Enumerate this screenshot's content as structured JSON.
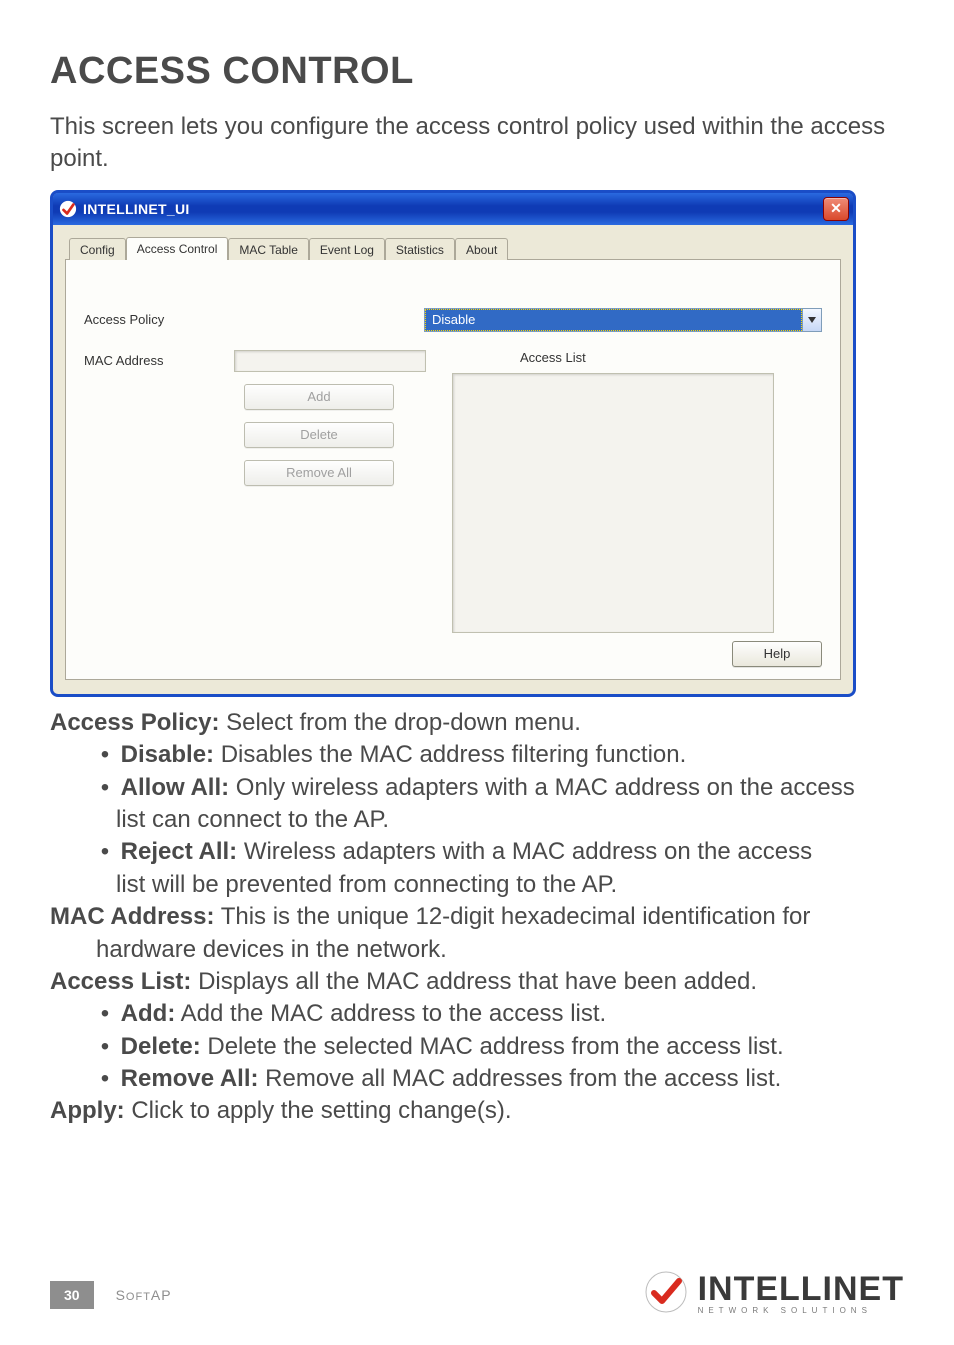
{
  "title": "ACCESS CONTROL",
  "intro": "This screen lets you configure the access control policy used within the access point.",
  "win": {
    "title": "INTELLINET_UI",
    "close": "✕",
    "tabs": {
      "config": "Config",
      "access_control": "Access Control",
      "mac_table": "MAC Table",
      "event_log": "Event Log",
      "statistics": "Statistics",
      "about": "About"
    },
    "labels": {
      "access_policy": "Access Policy",
      "mac_address": "MAC Address",
      "access_list": "Access List"
    },
    "combo_value": "Disable",
    "buttons": {
      "add": "Add",
      "delete": "Delete",
      "remove_all": "Remove All",
      "help": "Help"
    }
  },
  "definitions": {
    "access_policy_head": "Access Policy:",
    "access_policy_text": " Select from the drop-down menu.",
    "disable_head": "Disable:",
    "disable_text": " Disables the MAC address filtering function.",
    "allow_head": "Allow All:",
    "allow_text1": " Only wireless adapters with a MAC address on the access",
    "allow_text2": "list can connect to the AP.",
    "reject_head": "Reject All:",
    "reject_text1": " Wireless adapters with a MAC address on the access",
    "reject_text2": "list will be prevented from connecting to the AP.",
    "mac_head": "MAC Address:",
    "mac_text1": " This is the unique 12-digit hexadecimal identification for",
    "mac_text2": "hardware devices in the network.",
    "accesslist_head": "Access List:",
    "accesslist_text": " Displays all the MAC address that have been added.",
    "add_head": "Add:",
    "add_text": " Add the MAC address to the access list.",
    "delete_head": "Delete:",
    "delete_text": " Delete the selected MAC address from the access list.",
    "remove_head": "Remove All:",
    "remove_text": " Remove all MAC addresses from the access list.",
    "apply_head": "Apply:",
    "apply_text": " Click to apply the setting change(s)."
  },
  "footer": {
    "page": "30",
    "section": "SoftAP",
    "brand_name": "INTELLINET",
    "brand_sub": "NETWORK SOLUTIONS"
  }
}
